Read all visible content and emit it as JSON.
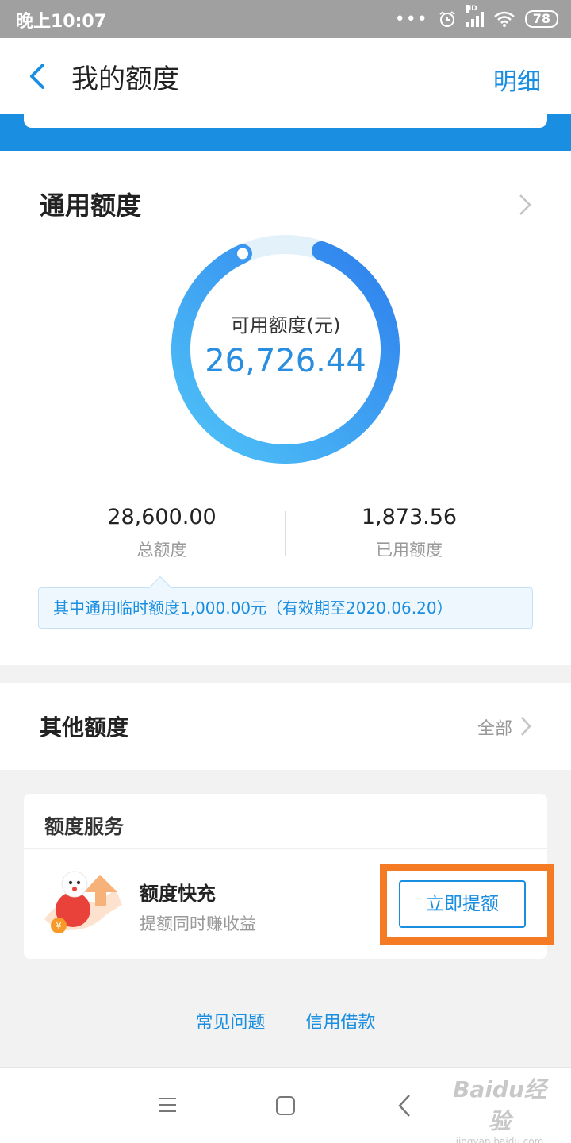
{
  "status_bar": {
    "time": "晚上10:07",
    "battery": "78",
    "network_badge": "HD",
    "more_glyph": "•••"
  },
  "header": {
    "title": "我的额度",
    "detail_link": "明细",
    "back_icon": "chevron-left-icon"
  },
  "general_quota": {
    "title": "通用额度",
    "available_label": "可用额度(元)",
    "available_value": "26,726.44",
    "used_fraction": 0.0655,
    "total_value": "28,600.00",
    "total_label": "总额度",
    "used_value": "1,873.56",
    "used_label": "已用额度",
    "temp_note": "其中通用临时额度1,000.00元（有效期至2020.06.20）"
  },
  "other_quota": {
    "title": "其他额度",
    "all_link": "全部"
  },
  "quota_service": {
    "title": "额度服务",
    "item_name": "额度快充",
    "item_desc": "提额同时赚收益",
    "button_label": "立即提额"
  },
  "footer_links": {
    "faq": "常见问题",
    "credit_loan": "信用借款"
  },
  "watermark": {
    "logo": "Baidu经验",
    "url": "jingyan.baidu.com"
  },
  "colors": {
    "accent": "#1a8ee0",
    "highlight": "#f47a24",
    "ring_start": "#4fc3f7",
    "ring_end": "#2f80ed"
  }
}
